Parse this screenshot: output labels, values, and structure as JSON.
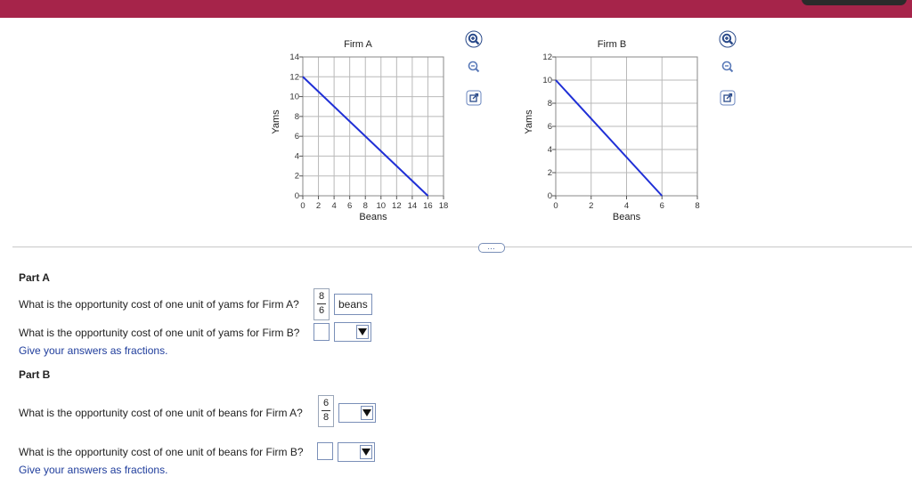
{
  "colors": {
    "topbar": "#a6244a",
    "line": "#1f2fd6",
    "link_text": "#1f3d9c"
  },
  "chart_data": [
    {
      "type": "line",
      "title": "Firm A",
      "xlabel": "Beans",
      "ylabel": "Yams",
      "xlim": [
        0,
        18
      ],
      "ylim": [
        0,
        14
      ],
      "x_ticks": [
        "0",
        "2",
        "4",
        "6",
        "8",
        "10",
        "12",
        "14",
        "16",
        "18"
      ],
      "y_ticks": [
        "0",
        "2",
        "4",
        "6",
        "8",
        "10",
        "12",
        "14"
      ],
      "grid": true,
      "series": [
        {
          "x": [
            0,
            16
          ],
          "y": [
            12,
            0
          ]
        }
      ]
    },
    {
      "type": "line",
      "title": "Firm B",
      "xlabel": "Beans",
      "ylabel": "Yams",
      "xlim": [
        0,
        8
      ],
      "ylim": [
        0,
        12
      ],
      "x_ticks": [
        "0",
        "2",
        "4",
        "6",
        "8"
      ],
      "y_ticks": [
        "0",
        "2",
        "4",
        "6",
        "8",
        "10",
        "12"
      ],
      "grid": true,
      "series": [
        {
          "x": [
            0,
            6
          ],
          "y": [
            10,
            0
          ]
        }
      ]
    }
  ],
  "toolbar_icons": [
    "zoom-in-icon",
    "zoom-out-icon",
    "popout-icon"
  ],
  "partA": {
    "heading": "Part A",
    "q1": "What is the opportunity cost of one unit of yams for Firm A?",
    "q1_numerator": "8",
    "q1_denominator": "6",
    "q1_unit": "beans",
    "q2": "What is the opportunity cost of one unit of yams for Firm B?",
    "hint": "Give your answers as fractions."
  },
  "partB": {
    "heading": "Part B",
    "q1": "What is the opportunity cost of one unit of beans for Firm A?",
    "q1_numerator": "6",
    "q1_denominator": "8",
    "q2": "What is the opportunity cost of one unit of beans for Firm B?",
    "hint": "Give your answers as fractions."
  }
}
